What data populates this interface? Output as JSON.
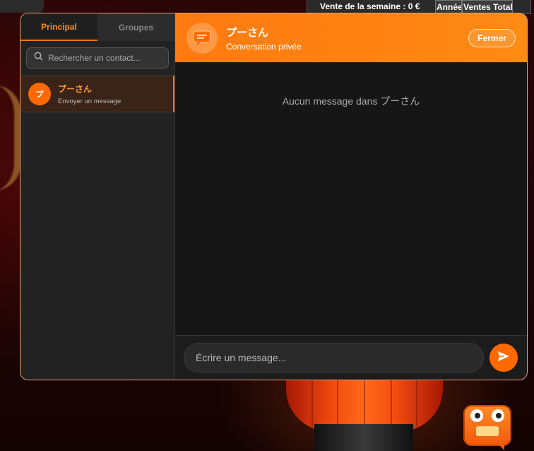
{
  "background": {
    "sales_table": {
      "weekly_sales": "Vente de la semaine : 0 €",
      "col_year": "Année",
      "col_total_sales": "Ventes Total"
    }
  },
  "chat": {
    "tabs": [
      {
        "label": "Principal",
        "active": true
      },
      {
        "label": "Groupes",
        "active": false
      }
    ],
    "search": {
      "placeholder": "Rechercher un contact..."
    },
    "contacts": [
      {
        "avatar_letter": "プ",
        "name": "プーさん",
        "subtitle": "Envoyer un message"
      }
    ],
    "header": {
      "title": "プーさん",
      "subtitle": "Conversation privée",
      "close_label": "Fermer",
      "icon": "chat-bubble-icon"
    },
    "messages": {
      "empty_text": "Aucun message dans プーさん"
    },
    "composer": {
      "placeholder": "Écrire un message...",
      "send_icon": "send-icon"
    }
  },
  "colors": {
    "accent": "#ff7a10",
    "panel": "#1c1c1c",
    "sidebar": "#222222"
  }
}
